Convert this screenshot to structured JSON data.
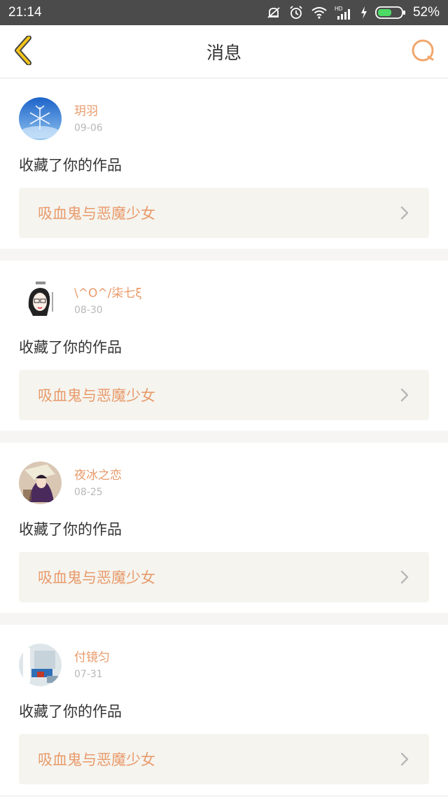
{
  "status_bar": {
    "time": "21:14",
    "battery_percent": "52%",
    "icons": [
      "mute-icon",
      "alarm-icon",
      "wifi-icon",
      "hd-signal-icon",
      "charging-icon",
      "battery-icon"
    ]
  },
  "header": {
    "title": "消息",
    "back_icon": "chevron-left-icon",
    "search_icon": "search-icon"
  },
  "colors": {
    "accent": "#e89a6a",
    "back_icon_fill": "#f5c518",
    "status_bar_bg": "#4b4b4b",
    "page_bg": "#f6f5f4"
  },
  "messages": [
    {
      "username": "玥羽",
      "date": "09-06",
      "action": "收藏了你的作品",
      "work_title": "吸血鬼与恶魔少女"
    },
    {
      "username": "\\^O^/柒七ξ",
      "date": "08-30",
      "action": "收藏了你的作品",
      "work_title": "吸血鬼与恶魔少女"
    },
    {
      "username": "夜冰之恋",
      "date": "08-25",
      "action": "收藏了你的作品",
      "work_title": "吸血鬼与恶魔少女"
    },
    {
      "username": "付镜匀",
      "date": "07-31",
      "action": "收藏了你的作品",
      "work_title": "吸血鬼与恶魔少女"
    }
  ]
}
